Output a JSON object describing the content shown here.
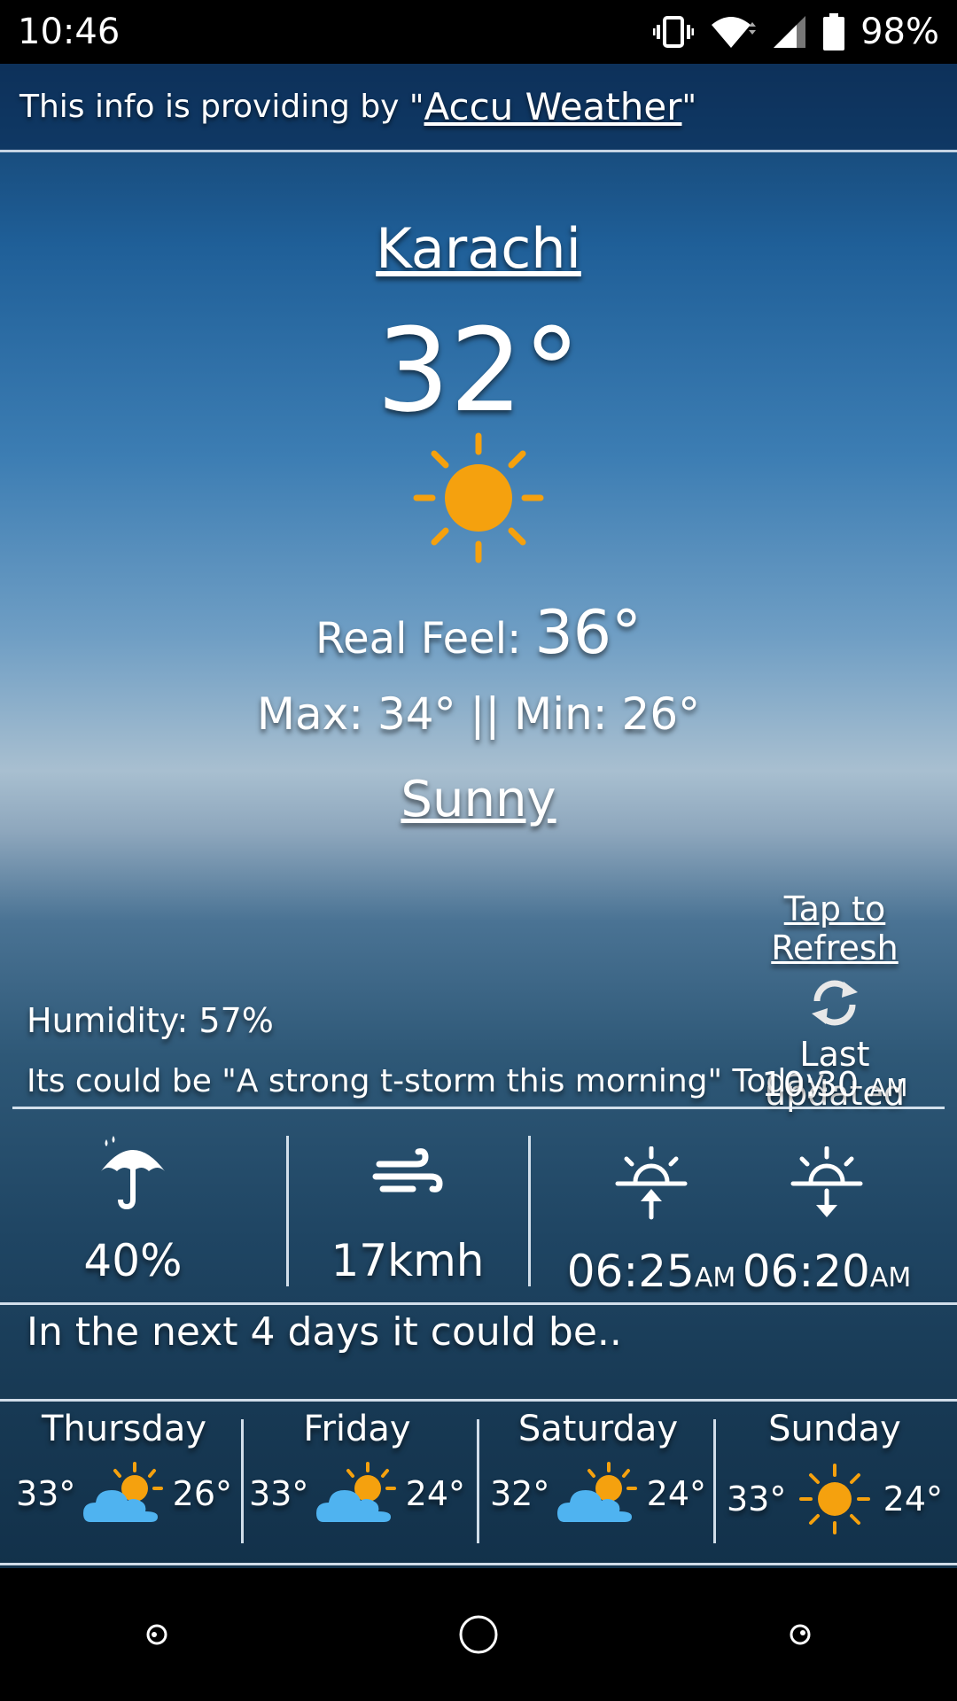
{
  "status_bar": {
    "time": "10:46",
    "battery": "98%",
    "icons": [
      "vibrate-icon",
      "wifi-icon",
      "signal-icon",
      "battery-icon"
    ]
  },
  "attribution": {
    "prefix": "This info is providing by \"",
    "link": "Accu Weather",
    "suffix": "\""
  },
  "current": {
    "city": "Karachi",
    "temperature": "32°",
    "icon": "sun-icon",
    "real_feel_label": "Real Feel: ",
    "real_feel_value": "36°",
    "max_min": "Max: 34° || Min: 26°",
    "condition": "Sunny"
  },
  "refresh": {
    "tap_label": "Tap to Refresh",
    "last_updated_label": "Last updated",
    "time": "10:30",
    "ampm": "AM"
  },
  "details": {
    "humidity": "Humidity: 57%",
    "forecast_text": "Its could be \"A strong t-storm this morning\" Today.."
  },
  "stats": {
    "rain": {
      "icon": "umbrella-rain-icon",
      "value": "40%"
    },
    "wind": {
      "icon": "wind-icon",
      "value": "17kmh"
    },
    "sunrise": {
      "icon": "sunrise-icon",
      "value": "06:25",
      "ampm": "AM"
    },
    "sunset": {
      "icon": "sunset-icon",
      "value": "06:20",
      "ampm": "AM"
    }
  },
  "next_days_title": "In the next 4 days it could be..",
  "forecast": [
    {
      "day": "Thursday",
      "hi": "33°",
      "lo": "26°",
      "icon": "partly-cloudy-icon"
    },
    {
      "day": "Friday",
      "hi": "33°",
      "lo": "24°",
      "icon": "partly-cloudy-icon"
    },
    {
      "day": "Saturday",
      "hi": "32°",
      "lo": "24°",
      "icon": "partly-cloudy-icon"
    },
    {
      "day": "Sunday",
      "hi": "33°",
      "lo": "24°",
      "icon": "sun-icon"
    }
  ],
  "colors": {
    "sun": "#f5a10e",
    "cloud": "#4fb3f0",
    "divider": "#e6f0fa"
  }
}
